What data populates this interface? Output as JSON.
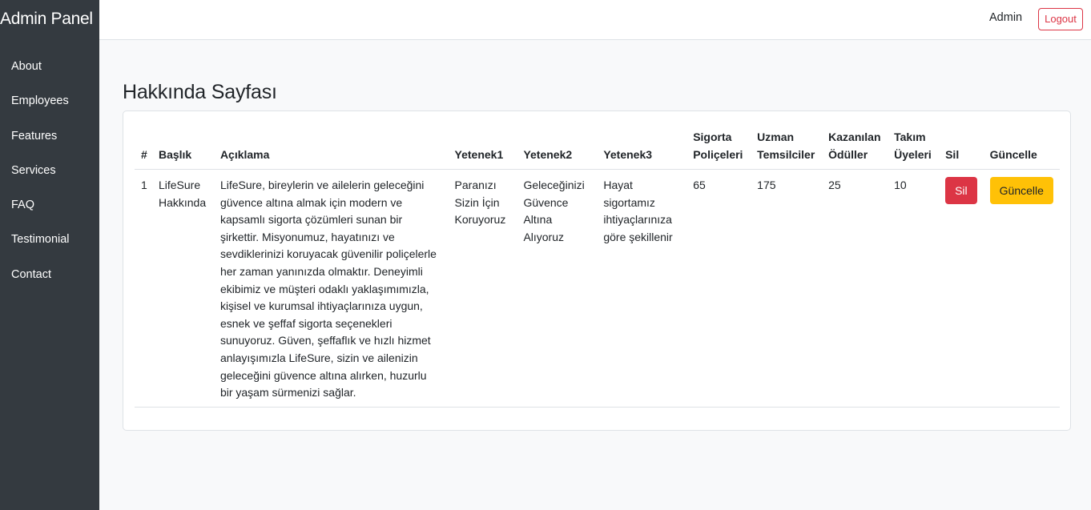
{
  "sidebar": {
    "brand": "Admin Panel",
    "items": [
      {
        "label": "About"
      },
      {
        "label": "Employees"
      },
      {
        "label": "Features"
      },
      {
        "label": "Services"
      },
      {
        "label": "FAQ"
      },
      {
        "label": "Testimonial"
      },
      {
        "label": "Contact"
      }
    ]
  },
  "topbar": {
    "user": "Admin",
    "logout_label": "Logout"
  },
  "page": {
    "title": "Hakkında Sayfası"
  },
  "table": {
    "headers": {
      "index": "#",
      "title": "Başlık",
      "description": "Açıklama",
      "skill1": "Yetenek1",
      "skill2": "Yetenek2",
      "skill3": "Yetenek3",
      "policies": "Sigorta Poliçeleri",
      "experts": "Uzman Temsilciler",
      "awards": "Kazanılan Ödüller",
      "team": "Takım Üyeleri",
      "delete": "Sil",
      "update": "Güncelle"
    },
    "rows": [
      {
        "index": "1",
        "title": "LifeSure Hakkında",
        "description": "LifeSure, bireylerin ve ailelerin geleceğini güvence altına almak için modern ve kapsamlı sigorta çözümleri sunan bir şirkettir. Misyonumuz, hayatınızı ve sevdiklerinizi koruyacak güvenilir poliçelerle her zaman yanınızda olmaktır. Deneyimli ekibimiz ve müşteri odaklı yaklaşımımızla, kişisel ve kurumsal ihtiyaçlarınıza uygun, esnek ve şeffaf sigorta seçenekleri sunuyoruz. Güven, şeffaflık ve hızlı hizmet anlayışımızla LifeSure, sizin ve ailenizin geleceğini güvence altına alırken, huzurlu bir yaşam sürmenizi sağlar.",
        "skill1": "Paranızı Sizin İçin Koruyoruz",
        "skill2": "Geleceğinizi Güvence Altına Alıyoruz",
        "skill3": "Hayat sigortamız ihtiyaçlarınıza göre şekillenir",
        "policies": "65",
        "experts": "175",
        "awards": "25",
        "team": "10",
        "delete_label": "Sil",
        "update_label": "Güncelle"
      }
    ]
  },
  "colors": {
    "sidebar_bg": "#343a40",
    "danger": "#dc3545",
    "warning": "#ffc107",
    "page_bg": "#f8f9fa"
  }
}
